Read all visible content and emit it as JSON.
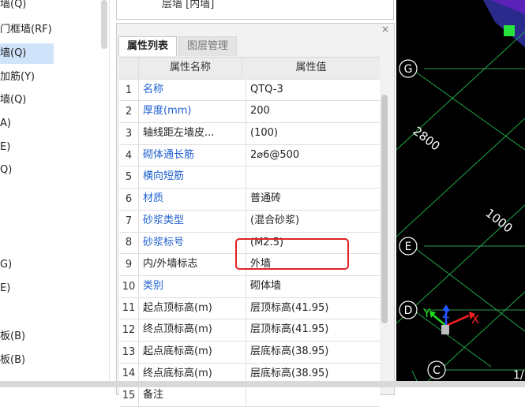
{
  "left_tree": {
    "items": [
      {
        "label": "墙(Q)",
        "selected": false
      },
      {
        "label": "门框墙(RF)",
        "selected": false
      },
      {
        "label": "墙(Q)",
        "selected": true
      },
      {
        "label": "加筋(Y)",
        "selected": false
      },
      {
        "label": "墙(Q)",
        "selected": false
      },
      {
        "label": "A)",
        "selected": false
      },
      {
        "label": "E)",
        "selected": false
      },
      {
        "label": "Q)",
        "selected": false
      },
      {
        "label": "G)",
        "selected": false
      },
      {
        "label": "E)",
        "selected": false
      },
      {
        "label": "板(B)",
        "selected": false
      },
      {
        "label": "板(B)",
        "selected": false
      }
    ]
  },
  "component_box": {
    "text": "层墙 [内墙]"
  },
  "panel": {
    "close": "×",
    "tabs": [
      {
        "label": "属性列表",
        "active": true
      },
      {
        "label": "图层管理",
        "active": false
      }
    ],
    "header": {
      "name": "属性名称",
      "value": "属性值"
    },
    "rows": [
      {
        "n": "1",
        "name": "名称",
        "value": "QTQ-3",
        "link": true
      },
      {
        "n": "2",
        "name": "厚度(mm)",
        "value": "200",
        "link": true
      },
      {
        "n": "3",
        "name": "轴线距左墙皮...",
        "value": "(100)",
        "link": false
      },
      {
        "n": "4",
        "name": "砌体通长筋",
        "value": "2⌀6@500",
        "link": true
      },
      {
        "n": "5",
        "name": "横向短筋",
        "value": "",
        "link": true
      },
      {
        "n": "6",
        "name": "材质",
        "value": "普通砖",
        "link": true
      },
      {
        "n": "7",
        "name": "砂浆类型",
        "value": "(混合砂浆)",
        "link": true
      },
      {
        "n": "8",
        "name": "砂浆标号",
        "value": "(M2.5)",
        "link": true
      },
      {
        "n": "9",
        "name": "内/外墙标志",
        "value": "外墙",
        "link": false
      },
      {
        "n": "10",
        "name": "类别",
        "value": "砌体墙",
        "link": true
      },
      {
        "n": "11",
        "name": "起点顶标高(m)",
        "value": "层顶标高(41.95)",
        "link": false
      },
      {
        "n": "12",
        "name": "终点顶标高(m)",
        "value": "层顶标高(41.95)",
        "link": false
      },
      {
        "n": "13",
        "name": "起点底标高(m)",
        "value": "层底标高(38.95)",
        "link": false
      },
      {
        "n": "14",
        "name": "终点底标高(m)",
        "value": "层底标高(38.95)",
        "link": false
      },
      {
        "n": "15",
        "name": "备注",
        "value": "",
        "link": false
      }
    ]
  },
  "cad": {
    "axes": [
      "G",
      "E",
      "D",
      "C"
    ],
    "dimensions": [
      "2800",
      "1000"
    ],
    "coord_labels": {
      "x": "X",
      "y": "Y",
      "z": "Z"
    },
    "corner_text": "1/",
    "colors": {
      "background": "#000000",
      "grid": "#1fa84a",
      "x": "#ff2020",
      "y": "#22dd22",
      "z": "#2255ff"
    }
  }
}
